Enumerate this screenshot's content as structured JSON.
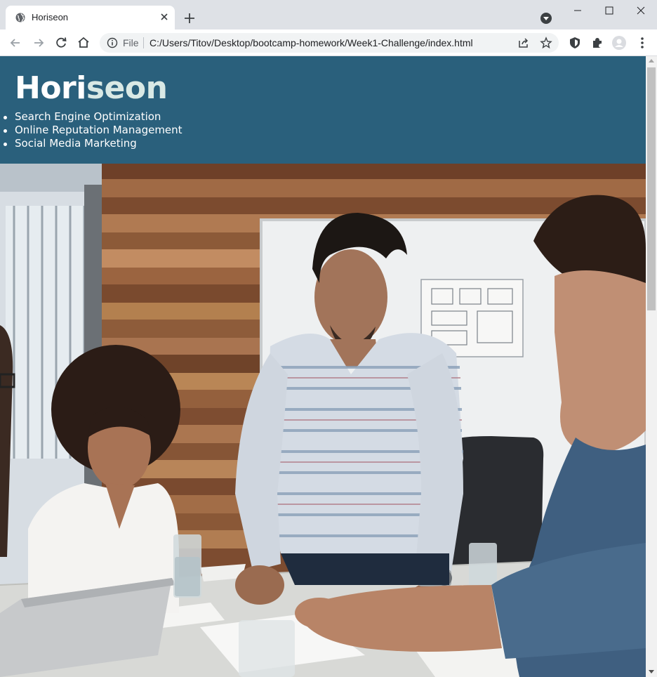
{
  "browser": {
    "tab_title": "Horiseon",
    "address_scheme_label": "File",
    "address_url": "C:/Users/Titov/Desktop/bootcamp-homework/Week1-Challenge/index.html",
    "icons": [
      "globe-icon",
      "close-icon",
      "plus-icon",
      "tab-search-icon",
      "minimize-icon",
      "maximize-icon",
      "window-close-icon",
      "back-icon",
      "forward-icon",
      "reload-icon",
      "home-icon",
      "info-icon",
      "share-icon",
      "star-icon",
      "shield-extension-icon",
      "puzzle-icon",
      "profile-icon",
      "menu-icon"
    ]
  },
  "page": {
    "logo": {
      "part1": "Hori",
      "part2": "seon"
    },
    "nav": [
      {
        "label": "Search Engine Optimization"
      },
      {
        "label": "Online Reputation Management"
      },
      {
        "label": "Social Media Marketing"
      }
    ],
    "hero_image": "business team meeting around a table with laptop and papers, wooden wall and whiteboard behind"
  },
  "colors": {
    "header_bg": "#2a607c",
    "seo_accent": "#d9e9e5",
    "tabstrip_bg": "#dee1e6"
  }
}
